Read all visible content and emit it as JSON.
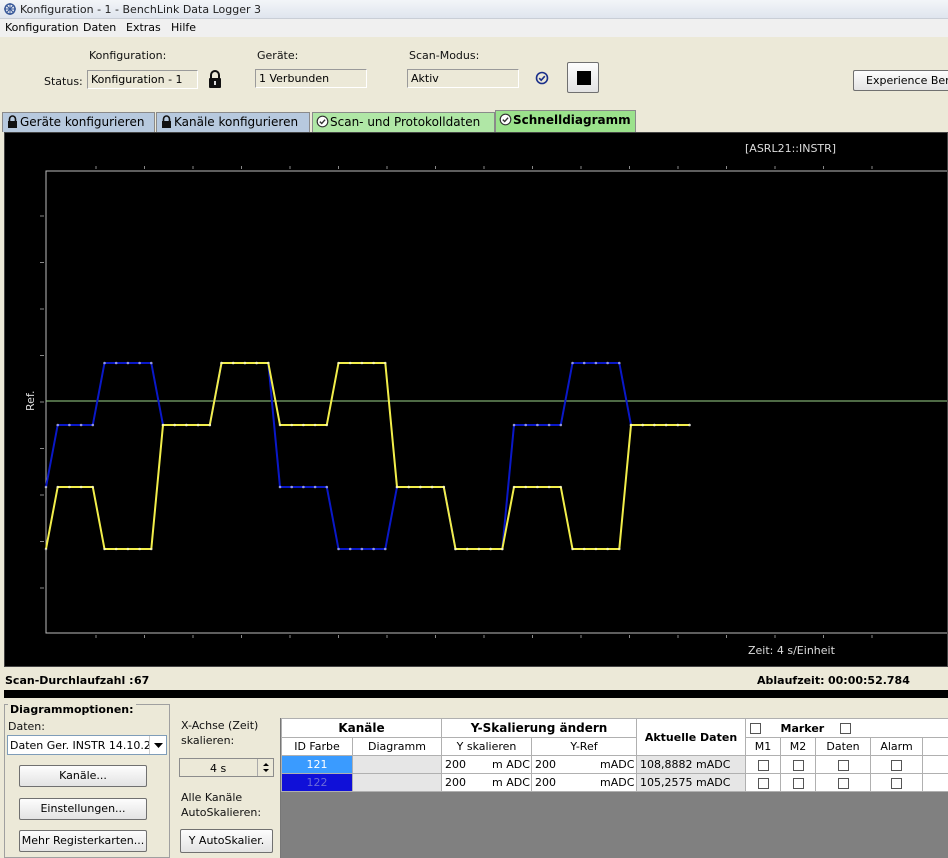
{
  "window": {
    "title": "Konfiguration - 1 - BenchLink Data Logger 3"
  },
  "menu": [
    "Konfiguration",
    "Daten",
    "Extras",
    "Hilfe"
  ],
  "toolbar": {
    "status_label": "Status:",
    "konfiguration_label": "Konfiguration:",
    "konfiguration_value": "Konfiguration - 1",
    "geraete_label": "Geräte:",
    "geraete_value": "1 Verbunden",
    "scanmodus_label": "Scan-Modus:",
    "scanmodus_value": "Aktiv",
    "experience_label": "Experience Benc"
  },
  "tabs": [
    {
      "label": "Geräte konfigurieren",
      "icon": "lock-icon"
    },
    {
      "label": "Kanäle konfigurieren",
      "icon": "lock-icon"
    },
    {
      "label": "Scan- und Protokolldaten",
      "icon": "check-circle-icon"
    },
    {
      "label": "Schnelldiagramm",
      "icon": "check-circle-icon"
    }
  ],
  "chart": {
    "instrument": "[ASRL21::INSTR]",
    "y_label": "Ref.",
    "x_caption": "Zeit: 4 s/Einheit"
  },
  "chart_data": {
    "type": "line",
    "ylabel": "Ref.",
    "xlabel": "Zeit: 4 s/Einheit",
    "x": [
      0,
      1,
      2,
      3,
      4,
      5,
      6,
      7,
      8,
      9,
      10,
      11,
      12,
      13,
      14,
      15,
      16,
      17,
      18,
      19,
      20,
      21,
      22,
      23,
      24,
      25,
      26,
      27,
      28,
      29,
      30,
      31,
      32,
      33,
      34,
      35,
      36,
      37,
      38,
      39,
      40,
      41,
      42,
      43,
      44,
      45,
      46,
      47,
      48,
      49,
      50,
      51,
      52,
      53,
      54,
      55
    ],
    "series": [
      {
        "values": [
          -2,
          -1,
          -1,
          -1,
          -1,
          0,
          0,
          0,
          0,
          0,
          -1,
          -1,
          -1,
          -1,
          -1,
          0,
          0,
          0,
          0,
          0,
          -2,
          -2,
          -2,
          -2,
          -2,
          -3,
          -3,
          -3,
          -3,
          -3,
          -2,
          -2,
          -2,
          -2,
          -2,
          -3,
          -3,
          -3,
          -3,
          -3,
          -1,
          -1,
          -1,
          -1,
          -1,
          0,
          0,
          0,
          0,
          0,
          -1,
          -1,
          -1,
          -1,
          -1,
          -1
        ],
        "color": "#0a18c8"
      },
      {
        "values": [
          -3,
          -2,
          -2,
          -2,
          -2,
          -3,
          -3,
          -3,
          -3,
          -3,
          -1,
          -1,
          -1,
          -1,
          -1,
          0,
          0,
          0,
          0,
          0,
          -1,
          -1,
          -1,
          -1,
          -1,
          0,
          0,
          0,
          0,
          0,
          -2,
          -2,
          -2,
          -2,
          -2,
          -3,
          -3,
          -3,
          -3,
          -3,
          -2,
          -2,
          -2,
          -2,
          -2,
          -3,
          -3,
          -3,
          -3,
          -3,
          -1,
          -1,
          -1,
          -1,
          -1,
          -1
        ],
        "color": "#f2ee4a"
      }
    ]
  },
  "status_line": {
    "scan_label": "Scan-Durchlaufzahl :",
    "scan_value": "67",
    "runtime_label": "Ablaufzeit:",
    "runtime_value": "00:00:52.784"
  },
  "options": {
    "legend": "Diagrammoptionen:",
    "daten_label": "Daten:",
    "daten_value": "Daten Ger. INSTR 14.10.2",
    "kanaele_button": "Kanäle...",
    "einstellungen_button": "Einstellungen...",
    "mehr_button": "Mehr Registerkarten..."
  },
  "xaxis": {
    "label": "X-Achse (Zeit) skalieren:",
    "spin_value": "4 s",
    "autoscale_label": "Alle Kanäle AutoSkalieren:",
    "autoscale_button": "Y AutoSkalier."
  },
  "grid": {
    "group_kanaele": "Kanäle",
    "group_yscale": "Y-Skalierung ändern",
    "group_aktuell": "Aktuelle Daten",
    "group_marker": "Marker",
    "col_id": "ID Farbe",
    "col_diagramm": "Diagramm",
    "col_yskal": "Y skalieren",
    "col_yref": "Y-Ref",
    "col_m1": "M1",
    "col_m2": "M2",
    "col_daten": "Daten",
    "col_alarm": "Alarm",
    "rows": [
      {
        "id": "121",
        "color": "#3a9bff",
        "yscale": "200",
        "yscale_unit": "m ADC",
        "yref": "200",
        "yref_unit": "mADC",
        "current": "108,8882 mADC"
      },
      {
        "id": "122",
        "color": "#1010d8",
        "yscale": "200",
        "yscale_unit": "m ADC",
        "yref": "200",
        "yref_unit": "mADC",
        "current": "105,2575 mADC"
      }
    ]
  }
}
